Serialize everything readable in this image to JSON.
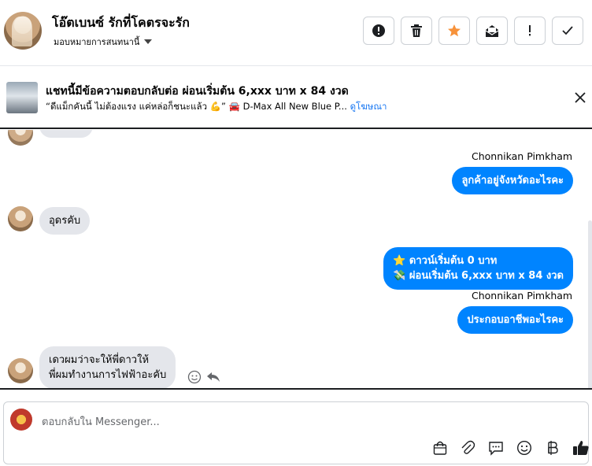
{
  "header": {
    "title": "โอ๊ตเบนซ์ รักที่โคตรจะรัก",
    "assign_label": "มอบหมายการสนทนานี้",
    "actions": [
      {
        "name": "report-button",
        "icon": "alert-circle-icon"
      },
      {
        "name": "delete-button",
        "icon": "trash-icon"
      },
      {
        "name": "star-button",
        "icon": "star-icon"
      },
      {
        "name": "mark-unread-button",
        "icon": "envelope-open-icon"
      },
      {
        "name": "spam-button",
        "icon": "exclamation-icon"
      },
      {
        "name": "done-button",
        "icon": "check-icon"
      }
    ]
  },
  "ad": {
    "title": "แชทนี้มีข้อความตอบกลับต่อ ผ่อนเริ่มต้น 6,xxx บาท x 84 งวด",
    "description": "“ดีแม็กคันนี้ ไม่ต้องแรง แค่หล่อก็ชนะแล้ว 💪” 🚘 D-Max All New Blue P...",
    "link": "ดูโฆษณา"
  },
  "messages": {
    "sender_name_1": "Chonnikan Pimkham",
    "out_1": "ลูกค้าอยู่จังหวัดอะไรคะ",
    "in_1": "อุดรคับ",
    "out_2_line1": "⭐ ดาวน์เริ่มต้น 0 บาท",
    "out_2_line2": "💸 ผ่อนเริ่มต้น 6,xxx บาท x 84 งวด",
    "sender_name_2": "Chonnikan Pimkham",
    "out_3": "ประกอบอาชีพอะไรคะ",
    "in_2_line1": "เดวผมว่าจะให้พี่ดาวให้",
    "in_2_line2": "พี่ผมทำงานการไฟฟ้าอะคับ"
  },
  "composer": {
    "placeholder": "ตอบกลับใน Messenger...",
    "tools": [
      "shopping-bag-icon",
      "paperclip-icon",
      "saved-reply-icon",
      "emoji-icon",
      "baht-icon",
      "thumbs-up-icon"
    ]
  },
  "colors": {
    "accent": "#0084ff",
    "star": "#f7923a",
    "incoming_bubble": "#e4e6eb"
  }
}
